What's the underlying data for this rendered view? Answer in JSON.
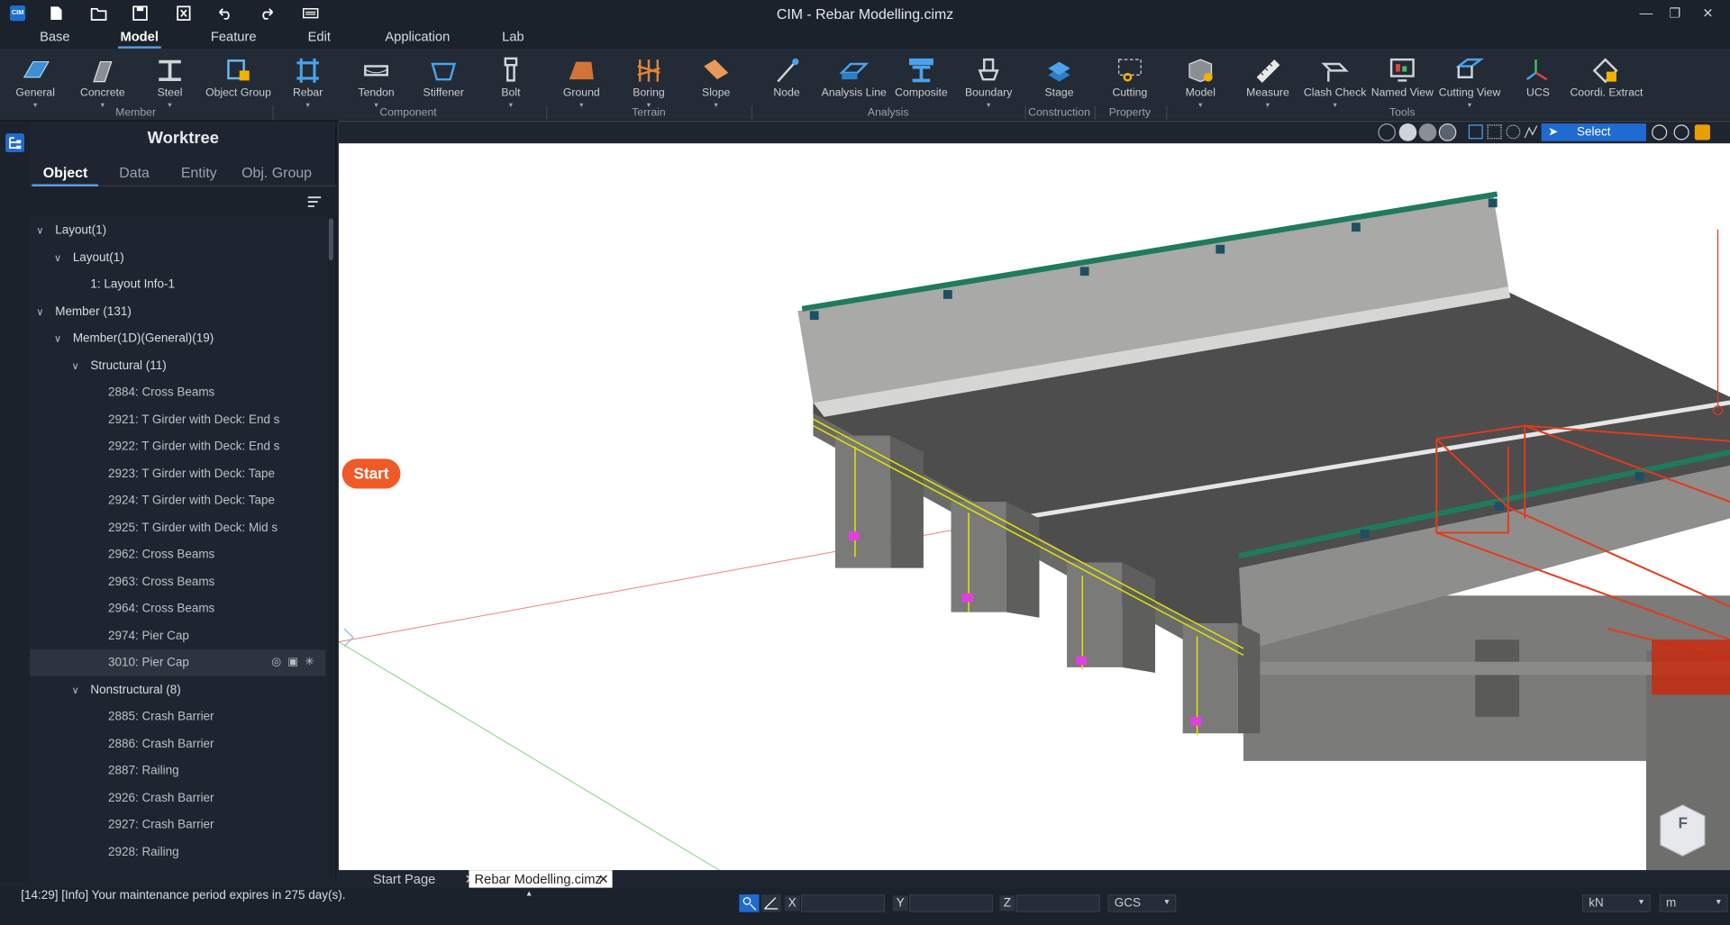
{
  "window": {
    "title": "CIM - Rebar Modelling.cimz",
    "logo_text": "CIM"
  },
  "quick_access": [
    "new-icon",
    "open-icon",
    "save-icon",
    "close-file-icon",
    "undo-icon",
    "redo-icon",
    "keyboard-icon"
  ],
  "menu": [
    "Base",
    "Model",
    "Feature",
    "Edit",
    "Application",
    "Lab"
  ],
  "ribbon": {
    "buttons": [
      "General",
      "Concrete",
      "Steel",
      "Object Group",
      "Rebar",
      "Tendon",
      "Stiffener",
      "Bolt",
      "Ground",
      "Boring",
      "Slope",
      "Node",
      "Analysis Line",
      "Composite",
      "Boundary",
      "Stage",
      "Cutting",
      "Model",
      "Measure",
      "Clash Check",
      "Named View",
      "Cutting View",
      "UCS",
      "Coordi. Extract"
    ],
    "groups": [
      "Member",
      "Component",
      "Terrain",
      "Analysis",
      "Construction",
      "Property",
      "Tools"
    ]
  },
  "worktree": {
    "title": "Worktree",
    "tabs": [
      "Object",
      "Data",
      "Entity",
      "Obj. Group"
    ],
    "nodes": [
      {
        "label": "Layout(1)",
        "level": 0,
        "expanded": true
      },
      {
        "label": "Layout(1)",
        "level": 1,
        "expanded": true
      },
      {
        "label": "1: Layout Info-1",
        "level": 2
      },
      {
        "label": "Member (131)",
        "level": 0,
        "expanded": true
      },
      {
        "label": "Member(1D)(General)(19)",
        "level": 1,
        "expanded": true
      },
      {
        "label": "Structural (11)",
        "level": 2,
        "expanded": true
      },
      {
        "label": "2884: Cross Beams",
        "level": 3
      },
      {
        "label": "2921: T Girder with Deck: End s",
        "level": 3
      },
      {
        "label": "2922: T Girder with Deck: End s",
        "level": 3
      },
      {
        "label": "2923: T Girder with Deck: Tape",
        "level": 3
      },
      {
        "label": "2924: T Girder with Deck: Tape",
        "level": 3
      },
      {
        "label": "2925: T Girder with Deck: Mid s",
        "level": 3
      },
      {
        "label": "2962: Cross Beams",
        "level": 3
      },
      {
        "label": "2963: Cross Beams",
        "level": 3
      },
      {
        "label": "2964: Cross Beams",
        "level": 3
      },
      {
        "label": "2974: Pier Cap",
        "level": 3
      },
      {
        "label": "3010: Pier Cap",
        "level": 3,
        "selected": true
      },
      {
        "label": "Nonstructural (8)",
        "level": 2,
        "expanded": true
      },
      {
        "label": "2885: Crash Barrier",
        "level": 3
      },
      {
        "label": "2886: Crash Barrier",
        "level": 3
      },
      {
        "label": "2887: Railing",
        "level": 3
      },
      {
        "label": "2926: Crash Barrier",
        "level": 3
      },
      {
        "label": "2927: Crash Barrier",
        "level": 3
      },
      {
        "label": "2928: Railing",
        "level": 3
      }
    ]
  },
  "viewport": {
    "select_label": "Select",
    "start_label": "Start",
    "cube_label": "F"
  },
  "doc_tabs": [
    "Start Page",
    "Rebar Modelling.cimz"
  ],
  "status": {
    "message": "[14:29] [Info] Your maintenance period expires in 275 day(s).",
    "x_label": "X",
    "y_label": "Y",
    "z_label": "Z",
    "x_value": "",
    "y_value": "",
    "z_value": "",
    "coord_system": "GCS",
    "force_unit": "kN",
    "length_unit": "m"
  },
  "colors": {
    "accent": "#1f6bd1",
    "start": "#f05a28",
    "concrete": "#9a9a98",
    "deck": "#4a4a4a",
    "rail": "#1f7a5e",
    "rebar": "#e6e600",
    "clash": "#e53a1a"
  }
}
